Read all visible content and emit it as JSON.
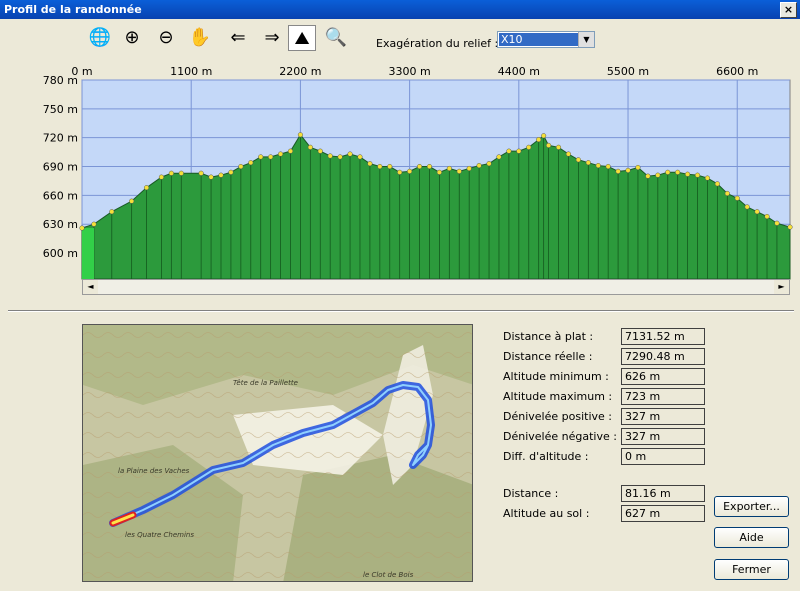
{
  "window": {
    "title": "Profil de la randonnée",
    "close_glyph": "×"
  },
  "toolbar": {
    "buttons": [
      {
        "name": "globe-search-icon",
        "glyph": "🌐"
      },
      {
        "name": "zoom-in-icon",
        "glyph": "⊕"
      },
      {
        "name": "zoom-out-icon",
        "glyph": "⊖"
      },
      {
        "name": "hand-pan-icon",
        "glyph": "✋"
      },
      {
        "name": "arrow-left-icon",
        "glyph": "⇐"
      },
      {
        "name": "arrow-right-icon",
        "glyph": "⇒"
      },
      {
        "name": "terrain-profile-icon",
        "glyph": "⛰"
      },
      {
        "name": "profile-search-icon",
        "glyph": "🔍"
      }
    ],
    "relief_label": "Exagération du relief :",
    "relief_value": "X10",
    "relief_arrow": "▼"
  },
  "chart_data": {
    "type": "area",
    "x_ticks": [
      "0 m",
      "1100 m",
      "2200 m",
      "3300 m",
      "4400 m",
      "5500 m",
      "6600 m"
    ],
    "x_tick_values": [
      0,
      1100,
      2200,
      3300,
      4400,
      5500,
      6600
    ],
    "y_ticks": [
      "780 m",
      "750 m",
      "720 m",
      "690 m",
      "660 m",
      "630 m",
      "600 m"
    ],
    "y_tick_values": [
      780,
      750,
      720,
      690,
      660,
      630,
      600
    ],
    "xlim": [
      0,
      7131.52
    ],
    "ylim": [
      573,
      780
    ],
    "grid": true,
    "fill_color": "#2c9a3c",
    "bg_color": "#c4d8f8",
    "x": [
      0,
      120,
      300,
      500,
      650,
      800,
      900,
      1000,
      1200,
      1300,
      1400,
      1500,
      1600,
      1700,
      1800,
      1900,
      2000,
      2100,
      2200,
      2300,
      2400,
      2500,
      2600,
      2700,
      2800,
      2900,
      3000,
      3100,
      3200,
      3300,
      3400,
      3500,
      3600,
      3700,
      3800,
      3900,
      4000,
      4100,
      4200,
      4300,
      4400,
      4500,
      4600,
      4650,
      4700,
      4800,
      4900,
      5000,
      5100,
      5200,
      5300,
      5400,
      5500,
      5600,
      5700,
      5800,
      5900,
      6000,
      6100,
      6200,
      6300,
      6400,
      6500,
      6600,
      6700,
      6800,
      6900,
      7000,
      7131.52
    ],
    "y": [
      626,
      630,
      643,
      654,
      668,
      679,
      683,
      683,
      683,
      679,
      681,
      684,
      690,
      694,
      700,
      700,
      703,
      706,
      723,
      710,
      706,
      701,
      700,
      703,
      700,
      693,
      690,
      690,
      684,
      685,
      690,
      690,
      684,
      688,
      685,
      688,
      691,
      693,
      700,
      706,
      706,
      710,
      718,
      722,
      712,
      710,
      703,
      697,
      694,
      691,
      690,
      685,
      686,
      689,
      680,
      681,
      684,
      684,
      682,
      681,
      678,
      672,
      662,
      657,
      648,
      643,
      638,
      631,
      627
    ]
  },
  "scroll": {
    "left_arrow": "◄",
    "right_arrow": "►"
  },
  "stats": [
    {
      "label": "Distance à plat :",
      "value": "7131.52 m"
    },
    {
      "label": "Distance réelle :",
      "value": "7290.48 m"
    },
    {
      "label": "Altitude minimum :",
      "value": "626 m"
    },
    {
      "label": "Altitude maximum :",
      "value": "723 m"
    },
    {
      "label": "Dénivelée positive :",
      "value": "327 m"
    },
    {
      "label": "Dénivelée négative :",
      "value": "327 m"
    },
    {
      "label": "Diff. d'altitude :",
      "value": "0 m"
    }
  ],
  "cursor_stats": [
    {
      "label": "Distance :",
      "value": "81.16 m"
    },
    {
      "label": "Altitude au sol :",
      "value": "627 m"
    }
  ],
  "buttons": {
    "export": "Exporter...",
    "help": "Aide",
    "close": "Fermer"
  },
  "map": {
    "labels": [
      "Tête de la Paillette",
      "la Plaine des Vaches",
      "les Quatre Chemins",
      "le Clot de Bois"
    ]
  }
}
